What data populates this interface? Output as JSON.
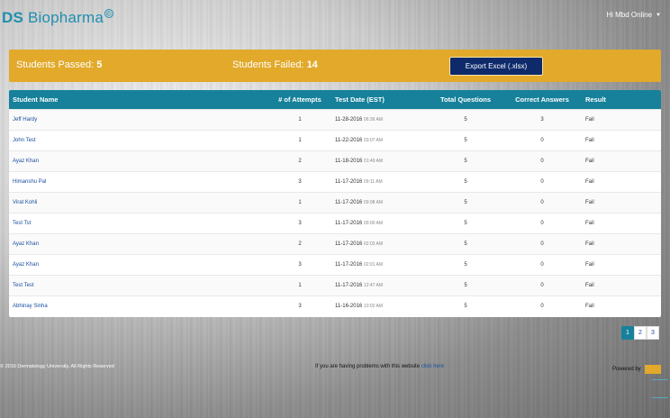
{
  "header": {
    "logo_bold": "DS",
    "logo_light": "Biopharma",
    "logo_mark": "©",
    "user_greeting": "Hi Mbd Online"
  },
  "summary": {
    "passed_label": "Students Passed:",
    "passed_count": "5",
    "failed_label": "Students Failed:",
    "failed_count": "14",
    "export_label": "Export Excel (.xlsx)"
  },
  "table": {
    "columns": [
      "Student Name",
      "# of Attempts",
      "Test Date (EST)",
      "Total Questions",
      "Correct Answers",
      "Result"
    ],
    "rows": [
      {
        "name": "Jeff Hardy",
        "attempts": "1",
        "date": "11-28-2016",
        "time": "06:36 AM",
        "total": "5",
        "correct": "3",
        "result": "Fail"
      },
      {
        "name": "John Test",
        "attempts": "1",
        "date": "11-22-2016",
        "time": "03:07 AM",
        "total": "5",
        "correct": "0",
        "result": "Fail"
      },
      {
        "name": "Ayaz Khan",
        "attempts": "2",
        "date": "11-18-2016",
        "time": "01:49 AM",
        "total": "5",
        "correct": "0",
        "result": "Fail"
      },
      {
        "name": "Himanshu Pal",
        "attempts": "3",
        "date": "11-17-2016",
        "time": "09:11 AM",
        "total": "5",
        "correct": "0",
        "result": "Fail"
      },
      {
        "name": "Virat Kohli",
        "attempts": "1",
        "date": "11-17-2016",
        "time": "09:08 AM",
        "total": "5",
        "correct": "0",
        "result": "Fail"
      },
      {
        "name": "Test Tst",
        "attempts": "3",
        "date": "11-17-2016",
        "time": "09:00 AM",
        "total": "5",
        "correct": "0",
        "result": "Fail"
      },
      {
        "name": "Ayaz Khan",
        "attempts": "2",
        "date": "11-17-2016",
        "time": "02:03 AM",
        "total": "5",
        "correct": "0",
        "result": "Fail"
      },
      {
        "name": "Ayaz Khan",
        "attempts": "3",
        "date": "11-17-2016",
        "time": "02:01 AM",
        "total": "5",
        "correct": "0",
        "result": "Fail"
      },
      {
        "name": "Test Test",
        "attempts": "1",
        "date": "11-17-2016",
        "time": "12:47 AM",
        "total": "5",
        "correct": "0",
        "result": "Fail"
      },
      {
        "name": "Abhinay Sinha",
        "attempts": "3",
        "date": "11-16-2016",
        "time": "10:02 AM",
        "total": "5",
        "correct": "0",
        "result": "Fail"
      }
    ]
  },
  "pagination": {
    "pages": [
      "1",
      "2",
      "3"
    ],
    "active": "1"
  },
  "footer": {
    "copyright": "© 2016 Dermatology University. All Rights Reserved",
    "help_prefix": "If you are having problems with this website",
    "help_link": "click here",
    "powered_by": "Powered by"
  },
  "colors": {
    "accent": "#e2a92a",
    "header": "#17819b",
    "button": "#0e2a6b"
  }
}
